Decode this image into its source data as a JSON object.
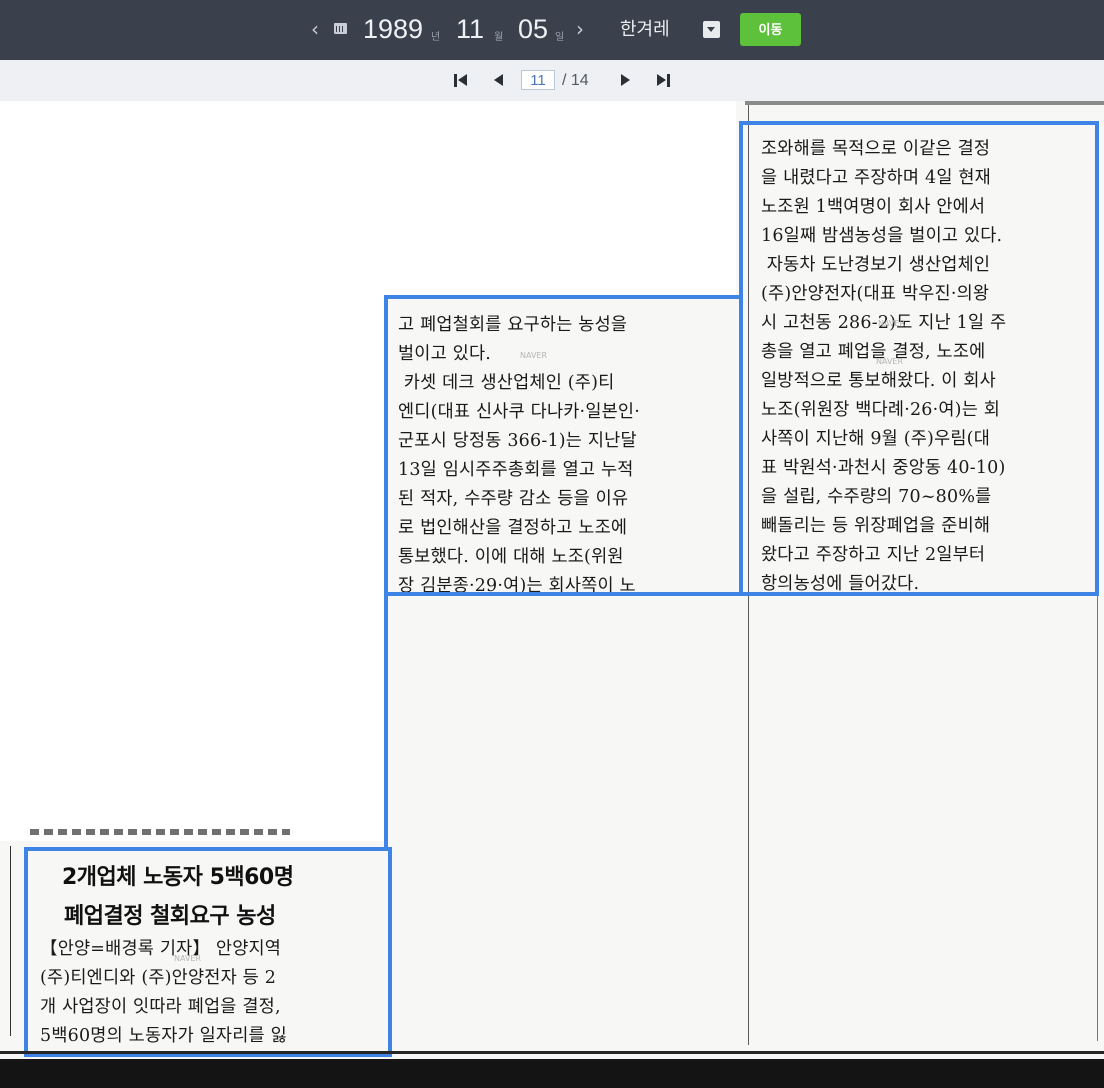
{
  "topbar": {
    "year": "1989",
    "year_unit": "년",
    "month": "11",
    "month_unit": "월",
    "day": "05",
    "day_unit": "일",
    "prev_arrow": "‹",
    "next_arrow": "›",
    "newspaper": "한겨레",
    "go_label": "이동",
    "go_color": "#5ec13b"
  },
  "pager": {
    "current_page": "11",
    "total_label": "/ 14"
  },
  "article": {
    "right_column_lines": [
      "조와해를 목적으로 이같은 결정",
      "을 내렸다고 주장하며 4일 현재",
      "노조원 1백여명이 회사 안에서",
      "16일째 밤샘농성을 벌이고 있다.",
      " 자동차 도난경보기 생산업체인",
      "(주)안양전자(대표 박우진·의왕",
      "시 고천동 286-2)도 지난 1일 주",
      "총을 열고 폐업을 결정, 노조에",
      "일방적으로 통보해왔다. 이 회사",
      "노조(위원장 백다례·26·여)는 회",
      "사쪽이 지난해 9월 (주)우림(대",
      "표 박원석·과천시 중앙동 40-10)",
      "을 설립, 수주량의 70~80%를",
      "빼돌리는 등 위장폐업을 준비해",
      "왔다고 주장하고 지난 2일부터",
      "항의농성에 들어갔다."
    ],
    "middle_column_lines": [
      "고 폐업철회를 요구하는 농성을",
      "벌이고 있다.",
      " 카셋 데크 생산업체인 (주)티",
      "엔디(대표 신사쿠 다나카·일본인·",
      "군포시 당정동 366-1)는 지난달",
      "13일 임시주주총회를 열고 누적",
      "된 적자, 수주량 감소 등을 이유",
      "로 법인해산을 결정하고 노조에",
      "통보했다. 이에 대해 노조(위원",
      "장 김분종·29·여)는 회사쪽이 노"
    ],
    "headline_1": "2개업체 노동자 5백60명",
    "headline_2": "폐업결정 철회요구 농성",
    "lead_lines": [
      "【안양=배경록 기자】 안양지역",
      "(주)티엔디와 (주)안양전자 등 2",
      "개 사업장이 잇따라 폐업을 결정,",
      "5백60명의 노동자가 일자리를 잃"
    ],
    "highlight_color": "#3d84e6"
  }
}
